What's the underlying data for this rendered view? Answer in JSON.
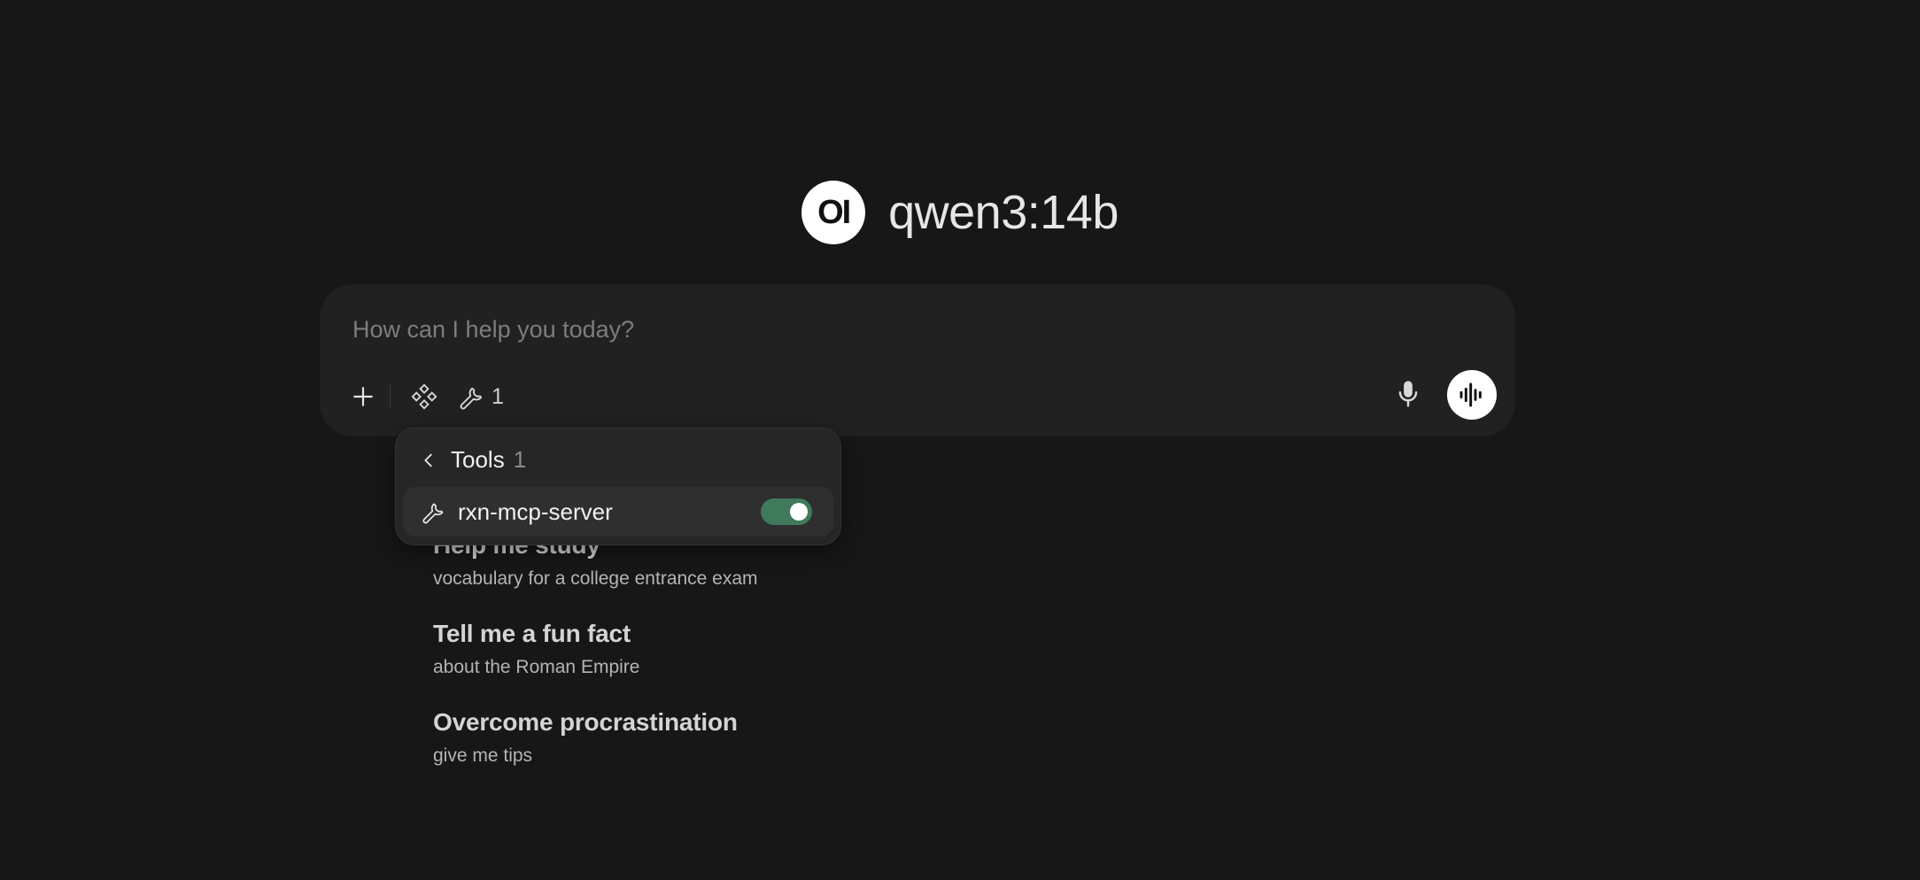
{
  "header": {
    "logo_text": "OI",
    "model_name": "qwen3:14b"
  },
  "composer": {
    "placeholder": "How can I help you today?",
    "tools_count": "1",
    "icons": {
      "add": "plus-icon",
      "integrations": "diamond-grid-icon",
      "tools": "wrench-icon",
      "mic": "microphone-icon",
      "voice": "audio-waveform-icon"
    }
  },
  "tools_menu": {
    "title": "Tools",
    "count": "1",
    "items": [
      {
        "label": "rxn-mcp-server",
        "enabled": true
      }
    ],
    "toggle_color": "#3f7a5c"
  },
  "suggestions": [
    {
      "title": "Help me study",
      "subtitle": "vocabulary for a college entrance exam"
    },
    {
      "title": "Tell me a fun fact",
      "subtitle": "about the Roman Empire"
    },
    {
      "title": "Overcome procrastination",
      "subtitle": "give me tips"
    }
  ]
}
